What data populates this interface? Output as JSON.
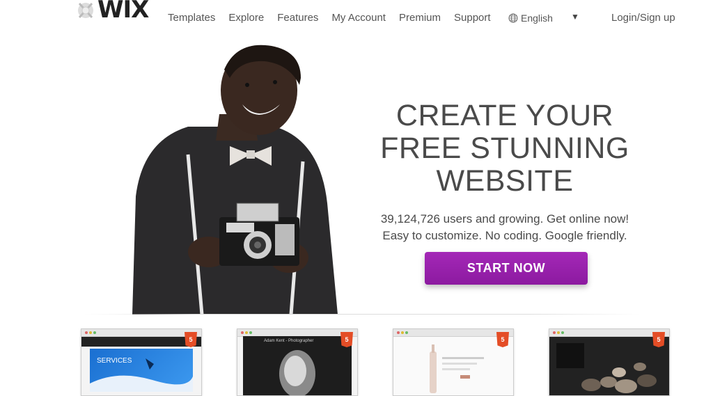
{
  "brand": {
    "logo_text": "WIX",
    "accent_color": "#9b22ad"
  },
  "nav": {
    "items": [
      "Templates",
      "Explore",
      "Features",
      "My Account",
      "Premium",
      "Support"
    ],
    "language": "English",
    "login": "Login/Sign up"
  },
  "hero": {
    "headline": [
      "CREATE YOUR",
      "FREE STUNNING",
      "WEBSITE"
    ],
    "subtext": [
      "39,124,726 users and growing. Get online now!",
      "Easy to customize. No coding. Google friendly."
    ],
    "cta": "START NOW"
  },
  "templates": {
    "badge": "5",
    "items": [
      {
        "text": "SERVICES"
      },
      {
        "text": "Adam Kent - Photographer"
      },
      {
        "text": ""
      },
      {
        "text": ""
      }
    ]
  }
}
